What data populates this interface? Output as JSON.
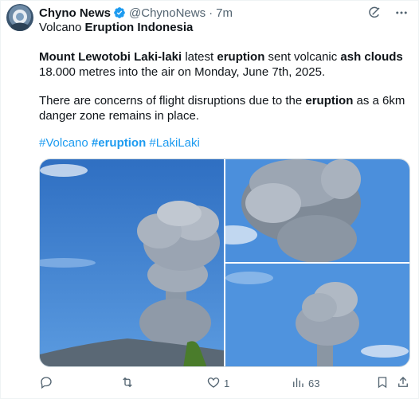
{
  "author": {
    "name": "Chyno News",
    "handle": "@ChynoNews",
    "separator": "·",
    "time": "7m"
  },
  "tweet": {
    "line1": {
      "t1": "Volcano ",
      "t2": "Eruption Indonesia"
    },
    "line2": {
      "t1": "Mount Lewotobi Laki-laki",
      "t2": " latest ",
      "t3": "eruption",
      "t4": " sent volcanic ",
      "t5": "ash clouds"
    },
    "line3": "18.000 metres into the air on Monday, June 7th, 2025.",
    "line4": {
      "t1": "There are concerns of flight disruptions due to the ",
      "t2": "eruption",
      "t3": " as a 6km"
    },
    "line5": "danger zone remains in place.",
    "hashtags": {
      "h1": "#Volcano",
      "h2": "#eruption",
      "h3": "#LakiLaki"
    }
  },
  "media": {
    "images": [
      "volcano-eruption-photo",
      "volcano-eruption-photo",
      "volcano-eruption-photo"
    ]
  },
  "actions": {
    "reply_count": "",
    "retweet_count": "",
    "like_count": "1",
    "views_count": "63"
  },
  "colors": {
    "accent": "#1d9bf0",
    "secondary_text": "#536471",
    "verified": "#1d9bf0"
  },
  "icons": [
    "grok-icon",
    "more-icon",
    "verified-icon",
    "reply-icon",
    "retweet-icon",
    "like-icon",
    "views-icon",
    "bookmark-icon",
    "share-icon"
  ]
}
